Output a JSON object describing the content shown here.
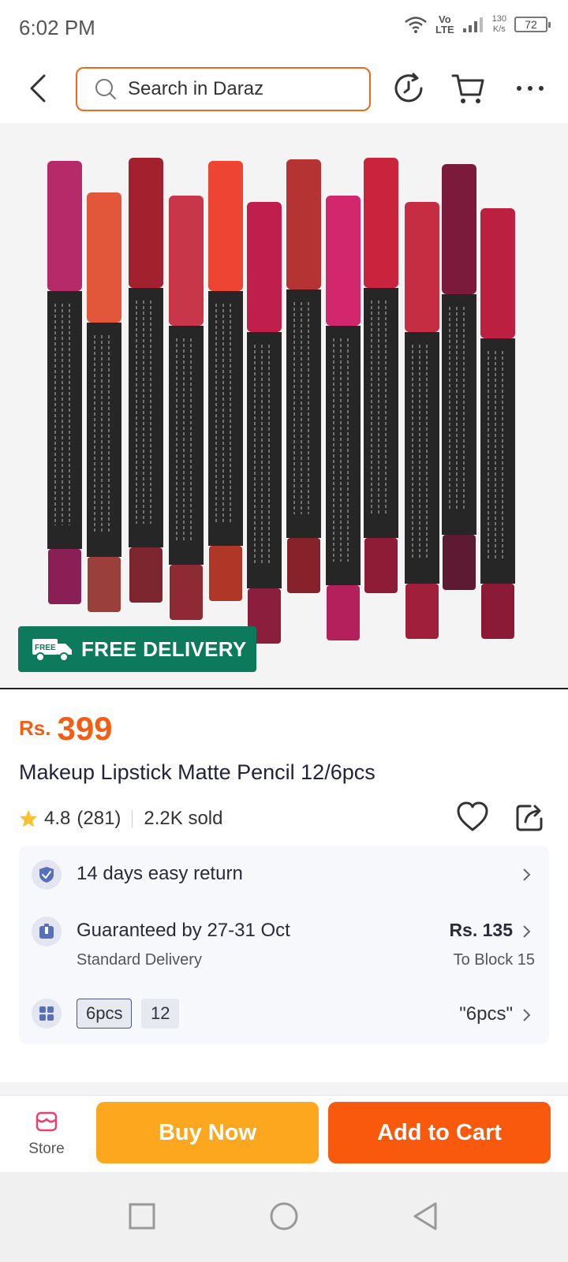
{
  "status_bar": {
    "time": "6:02 PM",
    "network_top": "Vo",
    "network_bottom": "LTE",
    "speed_value": "130",
    "speed_unit": "K/s",
    "battery": "72"
  },
  "header": {
    "search_placeholder": "Search in Daraz"
  },
  "product_image": {
    "badge_label": "FREE DELIVERY"
  },
  "product": {
    "currency": "Rs.",
    "price": "399",
    "title": "Makeup Lipstick Matte Pencil 12/6pcs",
    "rating": "4.8",
    "rating_count": "(281)",
    "sold": "2.2K sold"
  },
  "services": {
    "returns_label": "14 days easy return",
    "delivery_label": "Guaranteed by 27-31 Oct",
    "delivery_sub": "Standard Delivery",
    "delivery_price": "Rs. 135",
    "delivery_location": "To Block 15",
    "variant_options": [
      "6pcs",
      "12"
    ],
    "variant_selected": "\"6pcs\""
  },
  "bottom_bar": {
    "store_label": "Store",
    "buy_now": "Buy Now",
    "add_to_cart": "Add to Cart"
  },
  "colors": {
    "accent_orange": "#f8590d",
    "buy_now_yellow": "#fca71d",
    "free_delivery_green": "#0e7a5c",
    "price_orange": "#f45d14"
  },
  "product_image_swatches": [
    {
      "cap": "#b62a6a",
      "tip": "#8a1f55"
    },
    {
      "cap": "#e2563a",
      "tip": "#9a3f3a"
    },
    {
      "cap": "#a3202f",
      "tip": "#7e2630"
    },
    {
      "cap": "#c8364a",
      "tip": "#8d2a34"
    },
    {
      "cap": "#ee4433",
      "tip": "#b03628"
    },
    {
      "cap": "#c01f4b",
      "tip": "#8b1e3c"
    },
    {
      "cap": "#b53333",
      "tip": "#86222a"
    },
    {
      "cap": "#d2266d",
      "tip": "#b4205c"
    },
    {
      "cap": "#c8243e",
      "tip": "#8f1c36"
    },
    {
      "cap": "#c62c42",
      "tip": "#a0203c"
    },
    {
      "cap": "#7c1a3c",
      "tip": "#5f1a33"
    },
    {
      "cap": "#bd1f40",
      "tip": "#8a1a35"
    }
  ]
}
